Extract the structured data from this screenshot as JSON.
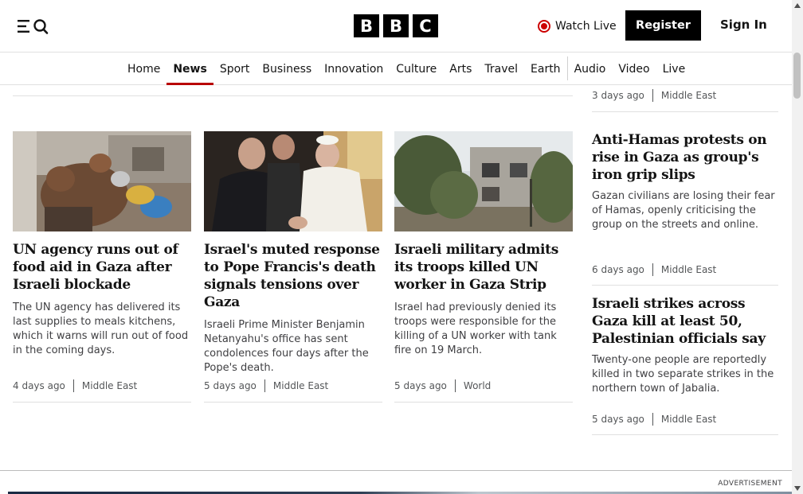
{
  "header": {
    "menu_icon": "menu-icon",
    "search_icon": "search-icon",
    "logo": [
      "B",
      "B",
      "C"
    ],
    "watch_live_label": "Watch Live",
    "register_label": "Register",
    "signin_label": "Sign In"
  },
  "nav": {
    "items": [
      "Home",
      "News",
      "Sport",
      "Business",
      "Innovation",
      "Culture",
      "Arts",
      "Travel",
      "Earth",
      "Audio",
      "Video",
      "Live"
    ],
    "active": "News"
  },
  "cards": [
    {
      "title": "UN agency runs out of food aid in Gaza after Israeli blockade",
      "description": "The UN agency has delivered its last supplies to meals kitchens, which it warns will run out of food in the coming days.",
      "time": "4 days ago",
      "topic": "Middle East"
    },
    {
      "title": "Israel's muted response to Pope Francis's death signals tensions over Gaza",
      "description": "Israeli Prime Minister Benjamin Netanyahu's office has sent condolences four days after the Pope's death.",
      "time": "5 days ago",
      "topic": "Middle East"
    },
    {
      "title": "Israeli military admits its troops killed UN worker in Gaza Strip",
      "description": "Israel had previously denied its troops were responsible for the killing of a UN worker with tank fire on 19 March.",
      "time": "5 days ago",
      "topic": "World"
    }
  ],
  "sidebar": {
    "top_meta": {
      "time": "3 days ago",
      "topic": "Middle East"
    },
    "stories": [
      {
        "title": "Anti-Hamas protests on rise in Gaza as group's iron grip slips",
        "description": "Gazan civilians are losing their fear of Hamas, openly criticising the group on the streets and online.",
        "time": "6 days ago",
        "topic": "Middle East"
      },
      {
        "title": "Israeli strikes across Gaza kill at least 50, Palestinian officials say",
        "description": "Twenty-one people are reportedly killed in two separate strikes in the northern town of Jabalia.",
        "time": "5 days ago",
        "topic": "Middle East"
      }
    ]
  },
  "advert": {
    "label": "ADVERTISEMENT"
  },
  "colors": {
    "accent": "#b80000",
    "live": "#cc0000",
    "text": "#141414",
    "muted": "#545658"
  }
}
